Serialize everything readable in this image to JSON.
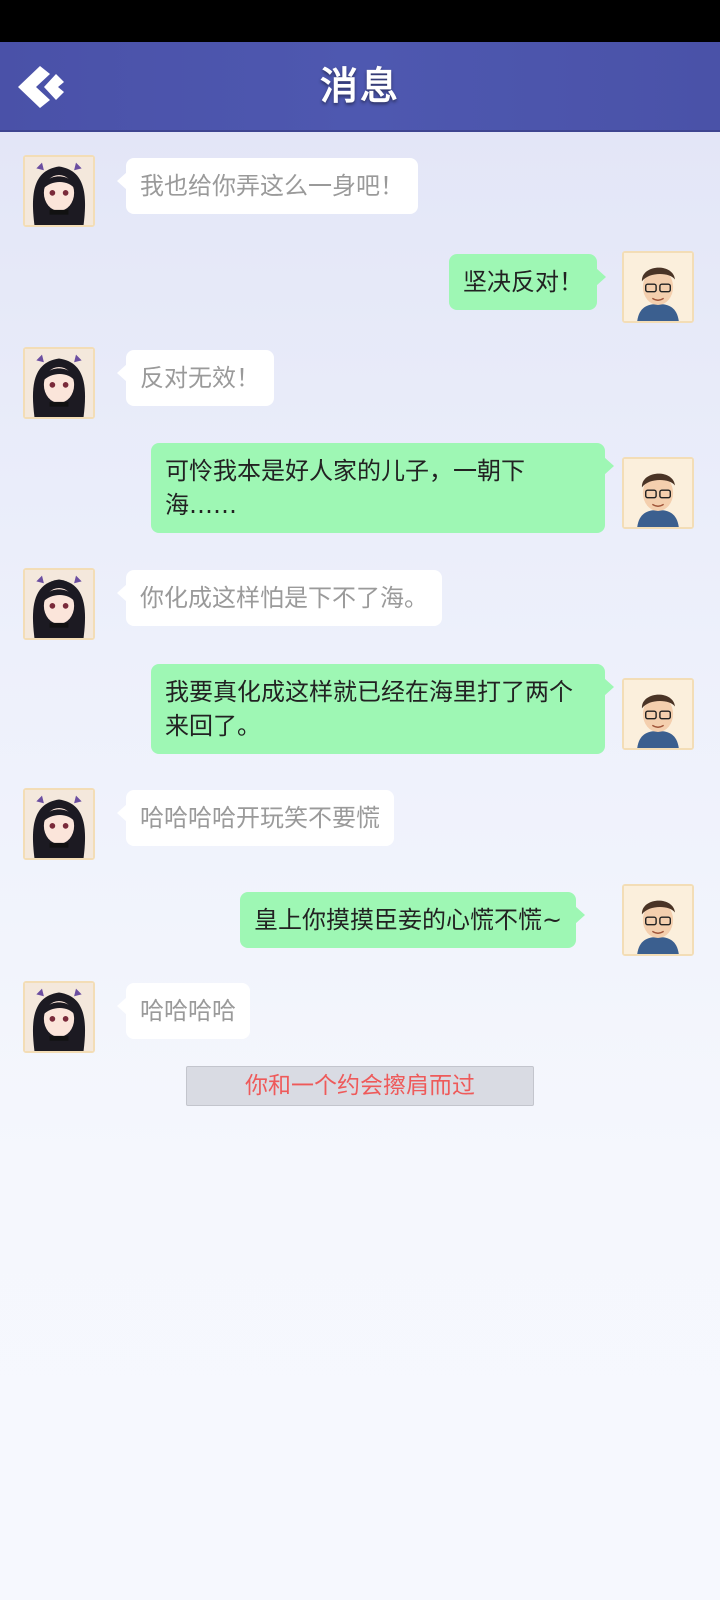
{
  "header": {
    "title": "消息",
    "back_icon": "back-arrow-icon"
  },
  "messages": [
    {
      "side": "left",
      "text": "我也给你弄这么一身吧！"
    },
    {
      "side": "right",
      "text": "坚决反对！"
    },
    {
      "side": "left",
      "text": "反对无效！"
    },
    {
      "side": "right",
      "text": "可怜我本是好人家的儿子，一朝下海……"
    },
    {
      "side": "left",
      "text": "你化成这样怕是下不了海。"
    },
    {
      "side": "right",
      "text": "我要真化成这样就已经在海里打了两个来回了。"
    },
    {
      "side": "left",
      "text": "哈哈哈哈开玩笑不要慌"
    },
    {
      "side": "right",
      "text": "皇上你摸摸臣妾的心慌不慌~"
    },
    {
      "side": "left",
      "text": "哈哈哈哈"
    }
  ],
  "system_notice": "你和一个约会擦肩而过",
  "colors": {
    "header": "#4e58b0",
    "bubble_left": "#ffffff",
    "bubble_right": "#9ef7b4",
    "notice_text": "#ee5a5a"
  }
}
